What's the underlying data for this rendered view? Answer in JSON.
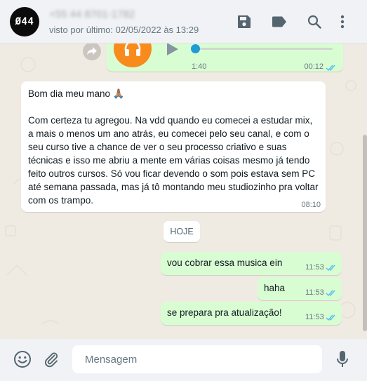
{
  "header": {
    "avatar_text": "Ø44",
    "contact_name": "+55 44 8701-1782",
    "last_seen": "visto por último: 02/05/2022 às 13:29",
    "icons": [
      "save-icon",
      "label-icon",
      "search-icon",
      "menu-icon"
    ]
  },
  "audio_message": {
    "duration": "1:40",
    "time": "00:12",
    "progress": 0.0,
    "status": "read"
  },
  "incoming_message": {
    "text": "Bom dia meu mano 🙏🏽\n\nCom certeza tu agregou. Na vdd quando eu comecei a estudar mix, a mais o menos um ano atrás, eu comecei pelo seu canal, e com o seu curso tive a chance de ver o seu processo criativo e suas técnicas e isso me abriu a mente em várias coisas mesmo já tendo feito outros cursos. Só vou ficar devendo o som pois estava sem PC até semana passada, mas já tô montando meu studiozinho pra voltar com os trampo.",
    "time": "08:10"
  },
  "date_separator": "HOJE",
  "outgoing_messages": [
    {
      "text": "vou cobrar essa musica ein",
      "time": "11:53",
      "status": "read"
    },
    {
      "text": "haha",
      "time": "11:53",
      "status": "read"
    },
    {
      "text": "se prepara pra atualização!",
      "time": "11:53",
      "status": "read"
    }
  ],
  "footer": {
    "input_placeholder": "Mensagem",
    "icons": [
      "emoji-icon",
      "attach-icon",
      "microphone-icon"
    ]
  },
  "colors": {
    "header_bg": "#f0f2f5",
    "chat_bg": "#efeae2",
    "outgoing_bubble": "#d9fdd3",
    "incoming_bubble": "#ffffff",
    "read_ticks": "#53bdeb",
    "audio_avatar": "#f88b1b",
    "audio_knob": "#1f9bd6"
  }
}
